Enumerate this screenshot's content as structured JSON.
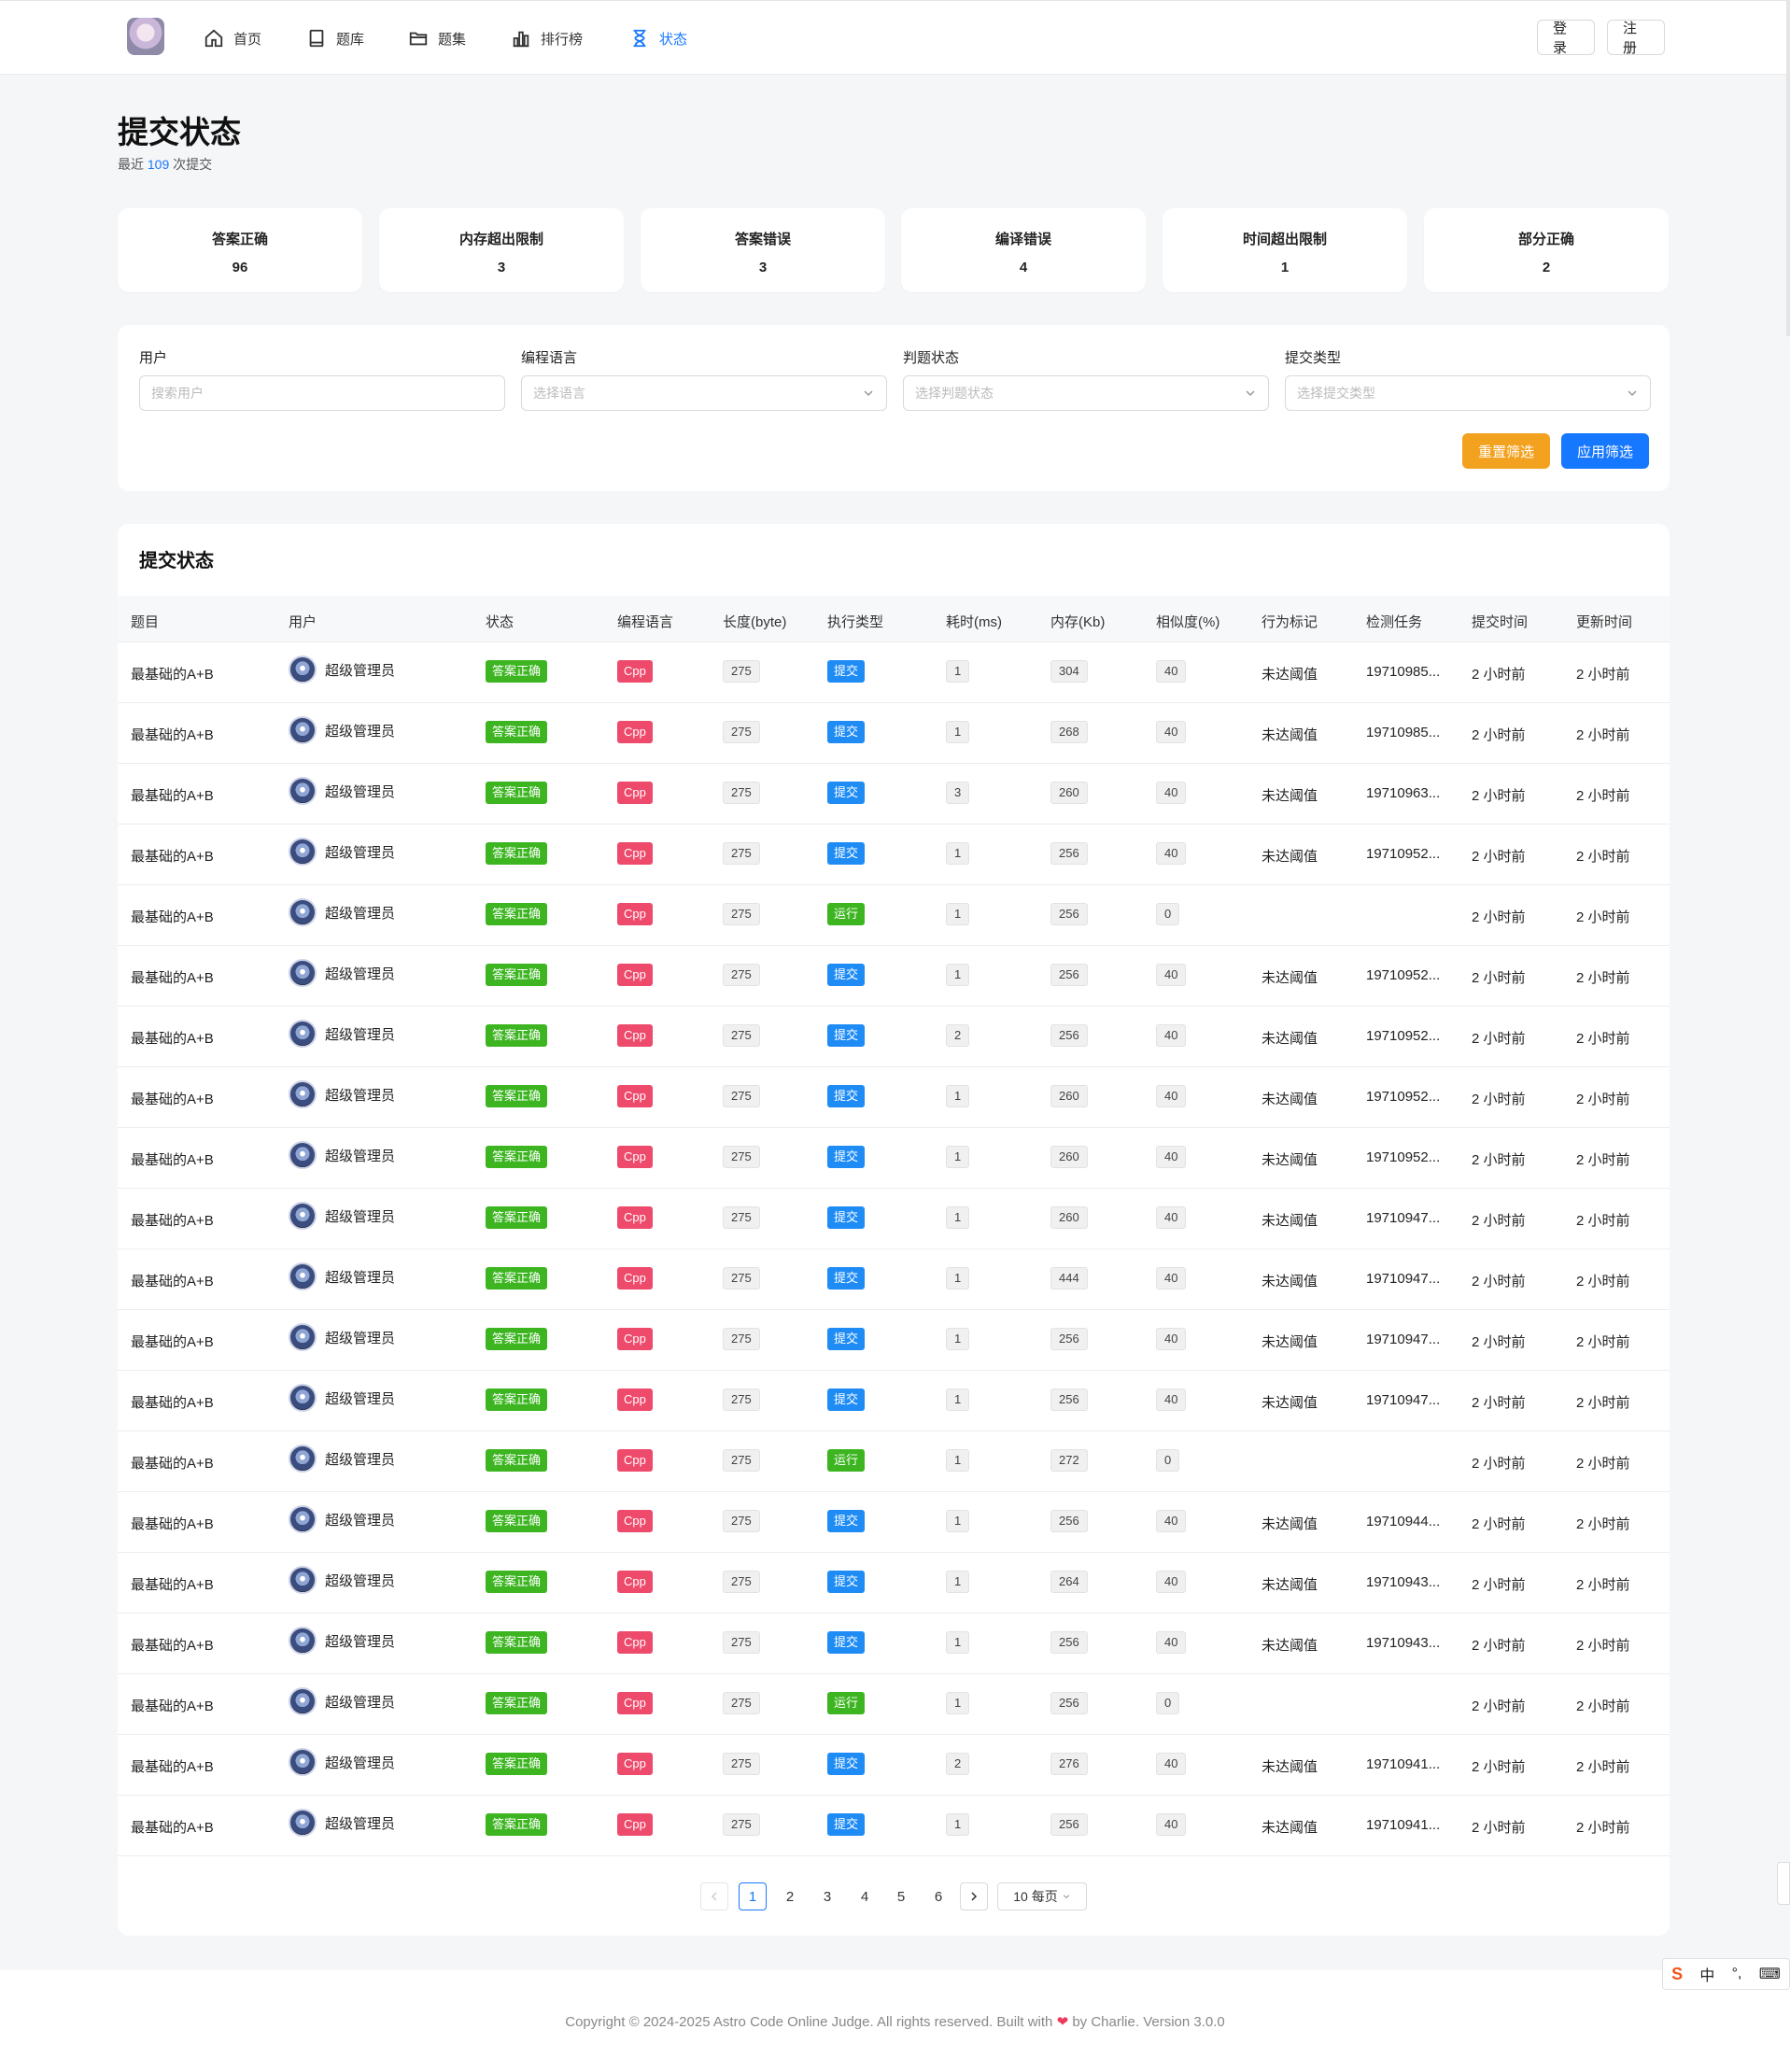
{
  "nav": {
    "items": [
      {
        "label": "首页",
        "icon": "home-icon"
      },
      {
        "label": "题库",
        "icon": "book-icon"
      },
      {
        "label": "题集",
        "icon": "folder-icon"
      },
      {
        "label": "排行榜",
        "icon": "bar-chart-icon"
      },
      {
        "label": "状态",
        "icon": "hourglass-icon",
        "active": true
      }
    ],
    "login": "登录",
    "register": "注册"
  },
  "header": {
    "title": "提交状态",
    "sub_prefix": "最近",
    "sub_count": "109",
    "sub_suffix": "次提交"
  },
  "stats": [
    {
      "label": "答案正确",
      "value": "96"
    },
    {
      "label": "内存超出限制",
      "value": "3"
    },
    {
      "label": "答案错误",
      "value": "3"
    },
    {
      "label": "编译错误",
      "value": "4"
    },
    {
      "label": "时间超出限制",
      "value": "1"
    },
    {
      "label": "部分正确",
      "value": "2"
    }
  ],
  "filters": {
    "user_label": "用户",
    "user_placeholder": "搜索用户",
    "lang_label": "编程语言",
    "lang_placeholder": "选择语言",
    "status_label": "判题状态",
    "status_placeholder": "选择判题状态",
    "type_label": "提交类型",
    "type_placeholder": "选择提交类型",
    "reset": "重置筛选",
    "apply": "应用筛选"
  },
  "table": {
    "title": "提交状态",
    "columns": [
      "题目",
      "用户",
      "状态",
      "编程语言",
      "长度(byte)",
      "执行类型",
      "耗时(ms)",
      "内存(Kb)",
      "相似度(%)",
      "行为标记",
      "检测任务",
      "提交时间",
      "更新时间"
    ],
    "rows": [
      {
        "problem": "最基础的A+B",
        "user": "超级管理员",
        "status": "答案正确",
        "lang": "Cpp",
        "length": "275",
        "type": "提交",
        "time": "1",
        "memory": "304",
        "similarity": "40",
        "flag": "未达阈值",
        "task": "19710985...",
        "submitted": "2 小时前",
        "updated": "2 小时前"
      },
      {
        "problem": "最基础的A+B",
        "user": "超级管理员",
        "status": "答案正确",
        "lang": "Cpp",
        "length": "275",
        "type": "提交",
        "time": "1",
        "memory": "268",
        "similarity": "40",
        "flag": "未达阈值",
        "task": "19710985...",
        "submitted": "2 小时前",
        "updated": "2 小时前"
      },
      {
        "problem": "最基础的A+B",
        "user": "超级管理员",
        "status": "答案正确",
        "lang": "Cpp",
        "length": "275",
        "type": "提交",
        "time": "3",
        "memory": "260",
        "similarity": "40",
        "flag": "未达阈值",
        "task": "19710963...",
        "submitted": "2 小时前",
        "updated": "2 小时前"
      },
      {
        "problem": "最基础的A+B",
        "user": "超级管理员",
        "status": "答案正确",
        "lang": "Cpp",
        "length": "275",
        "type": "提交",
        "time": "1",
        "memory": "256",
        "similarity": "40",
        "flag": "未达阈值",
        "task": "19710952...",
        "submitted": "2 小时前",
        "updated": "2 小时前"
      },
      {
        "problem": "最基础的A+B",
        "user": "超级管理员",
        "status": "答案正确",
        "lang": "Cpp",
        "length": "275",
        "type": "运行",
        "time": "1",
        "memory": "256",
        "similarity": "0",
        "flag": "",
        "task": "",
        "submitted": "2 小时前",
        "updated": "2 小时前"
      },
      {
        "problem": "最基础的A+B",
        "user": "超级管理员",
        "status": "答案正确",
        "lang": "Cpp",
        "length": "275",
        "type": "提交",
        "time": "1",
        "memory": "256",
        "similarity": "40",
        "flag": "未达阈值",
        "task": "19710952...",
        "submitted": "2 小时前",
        "updated": "2 小时前"
      },
      {
        "problem": "最基础的A+B",
        "user": "超级管理员",
        "status": "答案正确",
        "lang": "Cpp",
        "length": "275",
        "type": "提交",
        "time": "2",
        "memory": "256",
        "similarity": "40",
        "flag": "未达阈值",
        "task": "19710952...",
        "submitted": "2 小时前",
        "updated": "2 小时前"
      },
      {
        "problem": "最基础的A+B",
        "user": "超级管理员",
        "status": "答案正确",
        "lang": "Cpp",
        "length": "275",
        "type": "提交",
        "time": "1",
        "memory": "260",
        "similarity": "40",
        "flag": "未达阈值",
        "task": "19710952...",
        "submitted": "2 小时前",
        "updated": "2 小时前"
      },
      {
        "problem": "最基础的A+B",
        "user": "超级管理员",
        "status": "答案正确",
        "lang": "Cpp",
        "length": "275",
        "type": "提交",
        "time": "1",
        "memory": "260",
        "similarity": "40",
        "flag": "未达阈值",
        "task": "19710952...",
        "submitted": "2 小时前",
        "updated": "2 小时前"
      },
      {
        "problem": "最基础的A+B",
        "user": "超级管理员",
        "status": "答案正确",
        "lang": "Cpp",
        "length": "275",
        "type": "提交",
        "time": "1",
        "memory": "260",
        "similarity": "40",
        "flag": "未达阈值",
        "task": "19710947...",
        "submitted": "2 小时前",
        "updated": "2 小时前"
      },
      {
        "problem": "最基础的A+B",
        "user": "超级管理员",
        "status": "答案正确",
        "lang": "Cpp",
        "length": "275",
        "type": "提交",
        "time": "1",
        "memory": "444",
        "similarity": "40",
        "flag": "未达阈值",
        "task": "19710947...",
        "submitted": "2 小时前",
        "updated": "2 小时前"
      },
      {
        "problem": "最基础的A+B",
        "user": "超级管理员",
        "status": "答案正确",
        "lang": "Cpp",
        "length": "275",
        "type": "提交",
        "time": "1",
        "memory": "256",
        "similarity": "40",
        "flag": "未达阈值",
        "task": "19710947...",
        "submitted": "2 小时前",
        "updated": "2 小时前"
      },
      {
        "problem": "最基础的A+B",
        "user": "超级管理员",
        "status": "答案正确",
        "lang": "Cpp",
        "length": "275",
        "type": "提交",
        "time": "1",
        "memory": "256",
        "similarity": "40",
        "flag": "未达阈值",
        "task": "19710947...",
        "submitted": "2 小时前",
        "updated": "2 小时前"
      },
      {
        "problem": "最基础的A+B",
        "user": "超级管理员",
        "status": "答案正确",
        "lang": "Cpp",
        "length": "275",
        "type": "运行",
        "time": "1",
        "memory": "272",
        "similarity": "0",
        "flag": "",
        "task": "",
        "submitted": "2 小时前",
        "updated": "2 小时前"
      },
      {
        "problem": "最基础的A+B",
        "user": "超级管理员",
        "status": "答案正确",
        "lang": "Cpp",
        "length": "275",
        "type": "提交",
        "time": "1",
        "memory": "256",
        "similarity": "40",
        "flag": "未达阈值",
        "task": "19710944...",
        "submitted": "2 小时前",
        "updated": "2 小时前"
      },
      {
        "problem": "最基础的A+B",
        "user": "超级管理员",
        "status": "答案正确",
        "lang": "Cpp",
        "length": "275",
        "type": "提交",
        "time": "1",
        "memory": "264",
        "similarity": "40",
        "flag": "未达阈值",
        "task": "19710943...",
        "submitted": "2 小时前",
        "updated": "2 小时前"
      },
      {
        "problem": "最基础的A+B",
        "user": "超级管理员",
        "status": "答案正确",
        "lang": "Cpp",
        "length": "275",
        "type": "提交",
        "time": "1",
        "memory": "256",
        "similarity": "40",
        "flag": "未达阈值",
        "task": "19710943...",
        "submitted": "2 小时前",
        "updated": "2 小时前"
      },
      {
        "problem": "最基础的A+B",
        "user": "超级管理员",
        "status": "答案正确",
        "lang": "Cpp",
        "length": "275",
        "type": "运行",
        "time": "1",
        "memory": "256",
        "similarity": "0",
        "flag": "",
        "task": "",
        "submitted": "2 小时前",
        "updated": "2 小时前"
      },
      {
        "problem": "最基础的A+B",
        "user": "超级管理员",
        "status": "答案正确",
        "lang": "Cpp",
        "length": "275",
        "type": "提交",
        "time": "2",
        "memory": "276",
        "similarity": "40",
        "flag": "未达阈值",
        "task": "19710941...",
        "submitted": "2 小时前",
        "updated": "2 小时前"
      },
      {
        "problem": "最基础的A+B",
        "user": "超级管理员",
        "status": "答案正确",
        "lang": "Cpp",
        "length": "275",
        "type": "提交",
        "time": "1",
        "memory": "256",
        "similarity": "40",
        "flag": "未达阈值",
        "task": "19710941...",
        "submitted": "2 小时前",
        "updated": "2 小时前"
      }
    ]
  },
  "pagination": {
    "pages": [
      "1",
      "2",
      "3",
      "4",
      "5",
      "6"
    ],
    "current": "1",
    "page_size": "10 每页"
  },
  "footer": {
    "text_before": "Copyright © 2024-2025 Astro Code Online Judge. All rights reserved. Built with",
    "heart": "❤",
    "text_after": "by Charlie. Version 3.0.0"
  },
  "ime": {
    "logo": "S",
    "mode": "中",
    "punct": "°,",
    "keyboard": "⌨"
  },
  "colors": {
    "accent": "#1677ff",
    "success": "#3cb521",
    "lang_tag": "#ee4a6b",
    "submit_tag": "#1f8cf5",
    "reset_button": "#f3a21f"
  }
}
